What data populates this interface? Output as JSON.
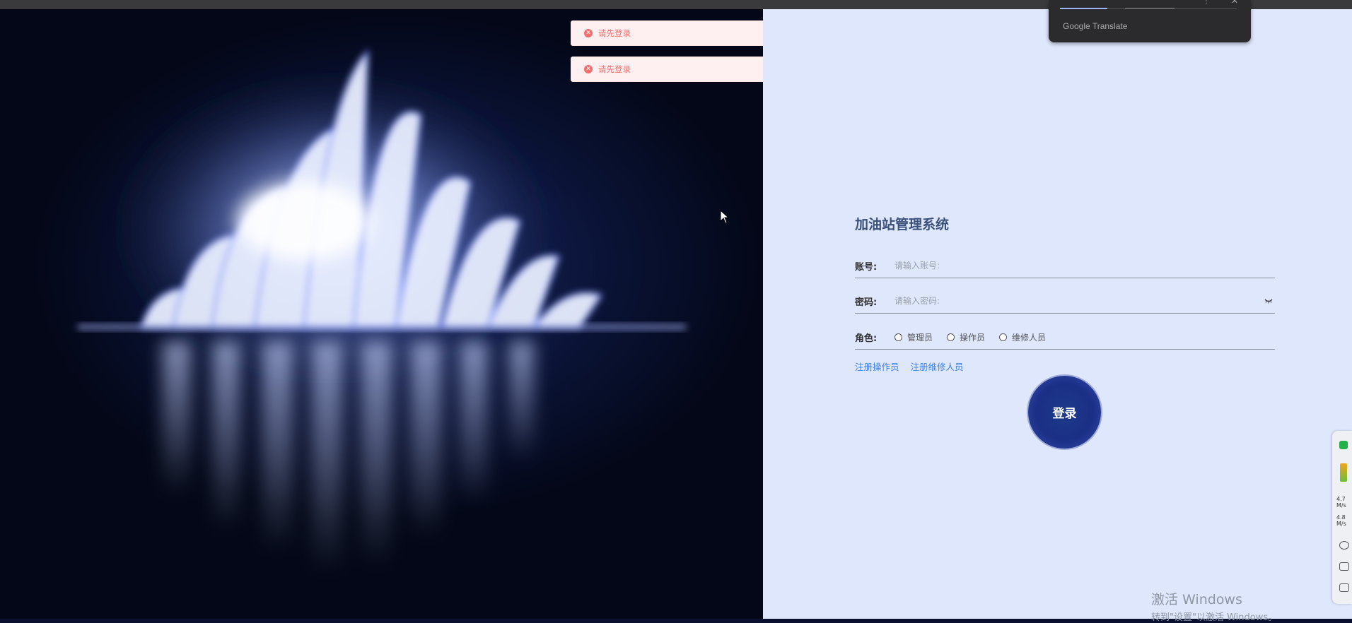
{
  "app": {
    "title": "加油站管理系统"
  },
  "form": {
    "account": {
      "label": "账号:",
      "placeholder": "请输入账号:",
      "value": ""
    },
    "password": {
      "label": "密码:",
      "placeholder": "请输入密码:",
      "value": ""
    },
    "role": {
      "label": "角色:",
      "options": [
        "管理员",
        "操作员",
        "维修人员"
      ],
      "selected": null
    },
    "links": {
      "register_operator": "注册操作员",
      "register_maintainer": "注册维修人员"
    },
    "login_button": "登录"
  },
  "toasts": [
    {
      "message": "请先登录",
      "type": "error"
    },
    {
      "message": "请先登录",
      "type": "error"
    }
  ],
  "translate_popup": {
    "brand": "Google Translate"
  },
  "side_widget": {
    "upload_speed": "4.7",
    "download_speed": "4.8",
    "unit": "M/s"
  },
  "watermark": {
    "line1": "激活 Windows",
    "line2": "转到\"设置\"以激活 Windows。"
  },
  "colors": {
    "login_button": "#1e3a8a",
    "panel_bg": "#dfe7fd",
    "link": "#3b82f6",
    "error": "#f56c6c"
  }
}
